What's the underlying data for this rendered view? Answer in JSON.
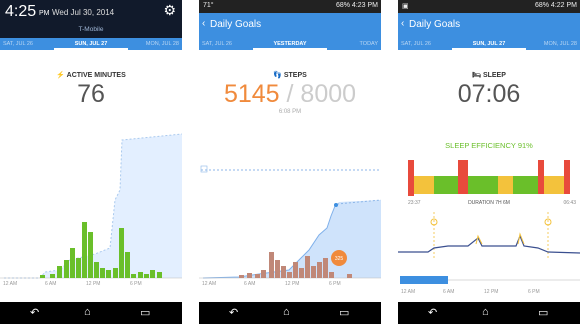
{
  "panel1": {
    "lock_time": "4:25",
    "pm": "PM",
    "lock_date": "Wed Jul 30, 2014",
    "carrier": "T-Mobile",
    "date_left": "SAT, JUL 26",
    "date_center": "SUN, JUL 27",
    "date_right": "MON, JUL 28",
    "metric_title": "ACTIVE MINUTES",
    "metric_value": "76",
    "x_ticks": [
      "12 AM",
      "6 AM",
      "12 PM",
      "6 PM"
    ]
  },
  "panel2": {
    "status_left": "71°",
    "status_right": "68% 4:23 PM",
    "title": "Daily Goals",
    "date_left": "SAT, JUL 26",
    "date_center": "YESTERDAY",
    "date_right": "TODAY",
    "metric_title": "STEPS",
    "steps_value": "5145",
    "steps_separator": "/",
    "steps_goal": "8000",
    "goal_time": "6:08 PM",
    "marker_label": "325",
    "x_ticks": [
      "12 AM",
      "6 AM",
      "12 PM",
      "6 PM"
    ]
  },
  "panel3": {
    "status_right": "68% 4:22 PM",
    "title": "Daily Goals",
    "date_left": "SAT, JUL 26",
    "date_center": "SUN, JUL 27",
    "date_right": "MON, JUL 28",
    "metric_title": "SLEEP",
    "metric_value": "07:06",
    "efficiency": "SLEEP EFFICIENCY 91%",
    "start_time": "23:37",
    "duration": "DURATION 7H 6M",
    "end_time": "06:43",
    "x_ticks": [
      "12 AM",
      "6 AM",
      "12 PM",
      "6 PM"
    ]
  },
  "colors": {
    "blue": "#3d8fe0",
    "green": "#6abf2a",
    "orange": "#f08a3c",
    "brown": "#c08878",
    "red": "#e84a3c",
    "yellow": "#f3c23c"
  },
  "icons": [
    "lightning-icon",
    "footprints-icon",
    "bed-icon",
    "gear-icon",
    "back-icon",
    "home-icon",
    "recents-icon",
    "chevron-left-icon"
  ]
}
